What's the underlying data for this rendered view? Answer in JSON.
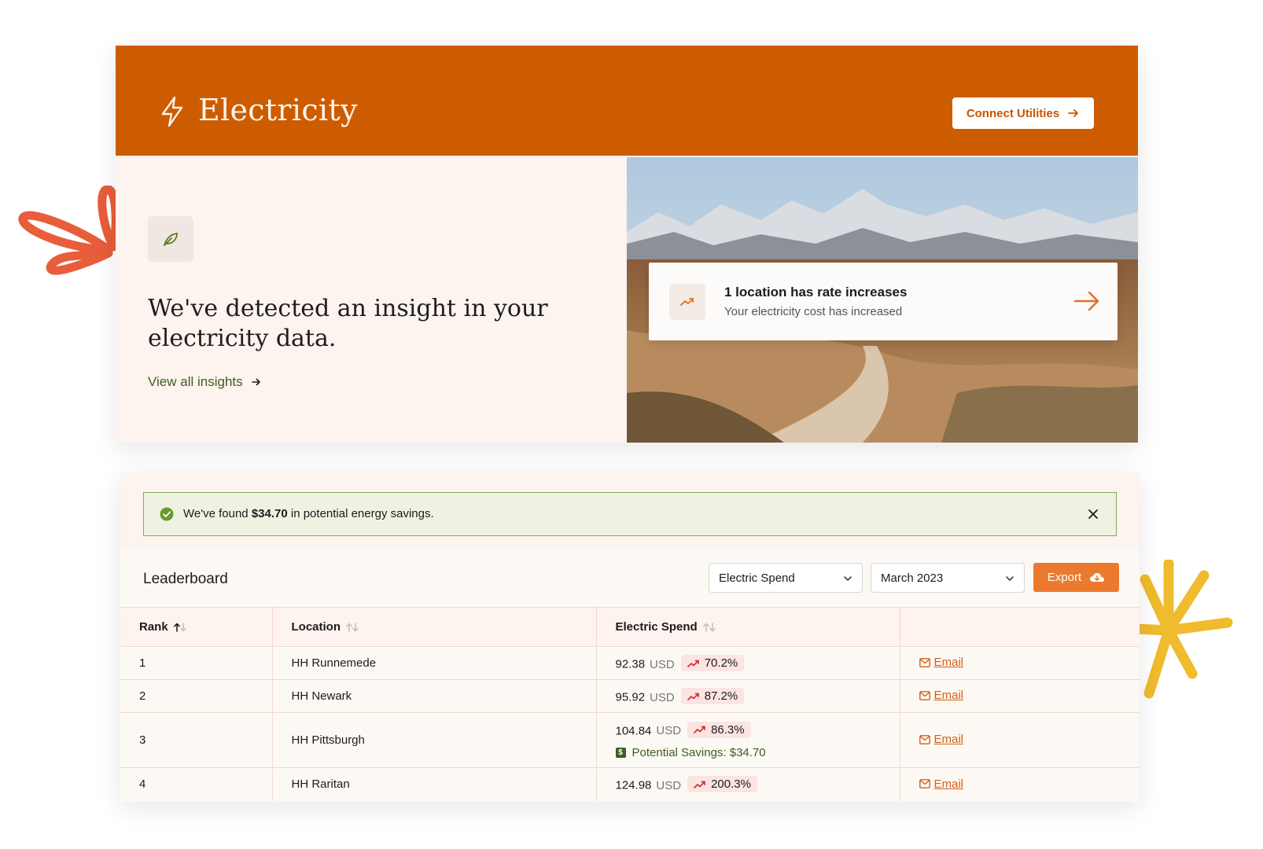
{
  "header": {
    "title": "Electricity",
    "connect_label": "Connect Utilities"
  },
  "insight": {
    "heading": "We've detected an insight in your electricity data.",
    "view_all_label": "View all insights",
    "card_title": "1 location has rate increases",
    "card_subtitle": "Your electricity cost has increased"
  },
  "banner": {
    "prefix": "We've found ",
    "amount": "$34.70",
    "suffix": " in potential energy savings."
  },
  "leaderboard": {
    "title": "Leaderboard",
    "metric_select": "Electric Spend",
    "month_select": "March 2023",
    "export_label": "Export",
    "columns": [
      "Rank",
      "Location",
      "Electric Spend",
      ""
    ],
    "rows": [
      {
        "rank": "1",
        "location": "HH Runnemede",
        "spend": "92.38",
        "unit": "USD",
        "change": "70.2%",
        "email": "Email"
      },
      {
        "rank": "2",
        "location": "HH Newark",
        "spend": "95.92",
        "unit": "USD",
        "change": "87.2%",
        "email": "Email"
      },
      {
        "rank": "3",
        "location": "HH Pittsburgh",
        "spend": "104.84",
        "unit": "USD",
        "change": "86.3%",
        "savings": "Potential Savings: $34.70",
        "email": "Email"
      },
      {
        "rank": "4",
        "location": "HH Raritan",
        "spend": "124.98",
        "unit": "USD",
        "change": "200.3%",
        "email": "Email"
      }
    ]
  },
  "colors": {
    "header_bg": "#cd5c00",
    "accent_orange": "#ec7a2e",
    "success_green": "#3f5e1c",
    "increase_red": "#d32f2f"
  }
}
